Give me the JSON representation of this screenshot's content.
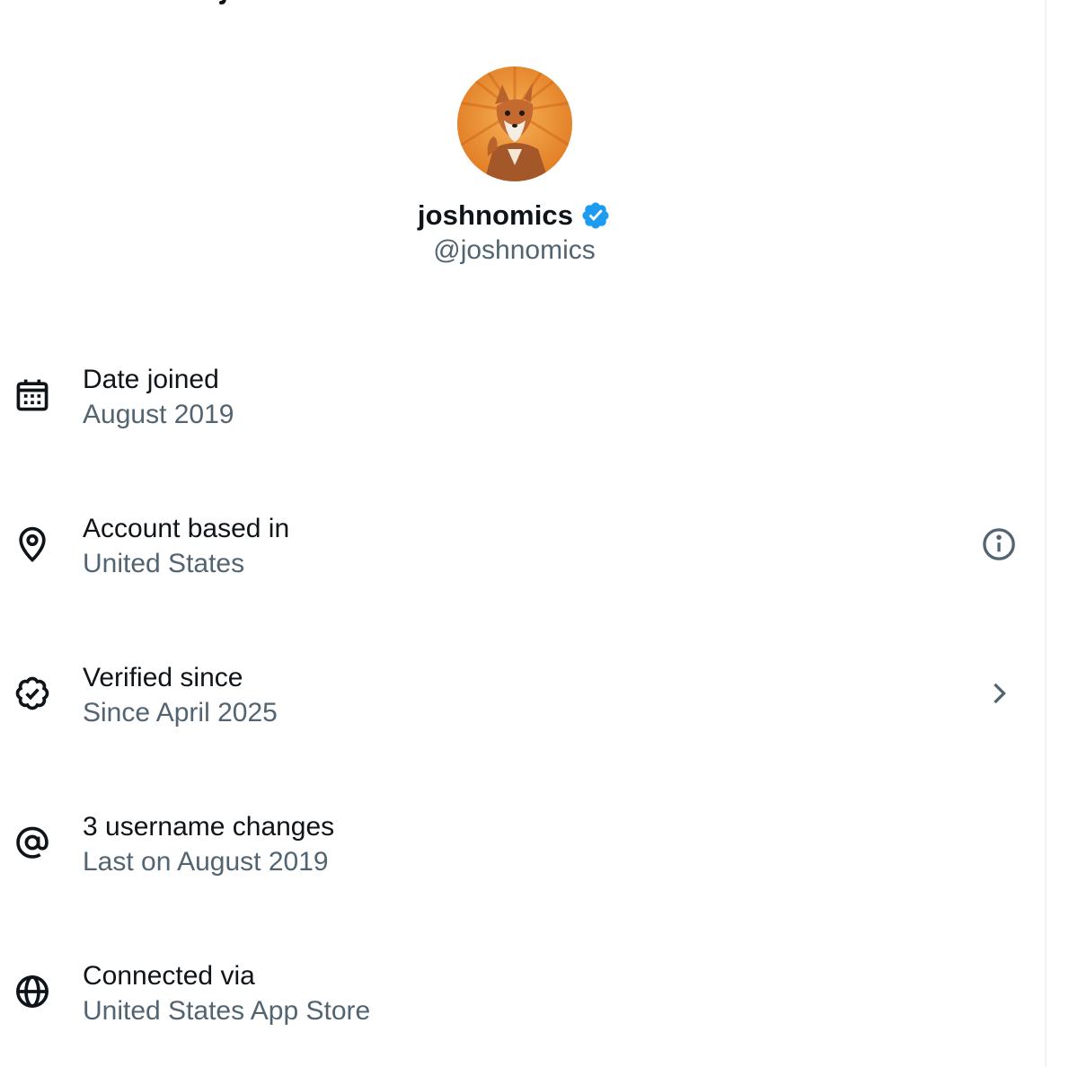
{
  "profile": {
    "display_name": "joshnomics",
    "handle": "@joshnomics",
    "verified": true
  },
  "colors": {
    "primary_text": "#0f1419",
    "secondary_text": "#536471",
    "verified_blue": "#1d9bf0",
    "avatar_orange": "#e8852a"
  },
  "rows": [
    {
      "icon": "calendar-icon",
      "label": "Date joined",
      "value": "August 2019",
      "action": null
    },
    {
      "icon": "location-pin-icon",
      "label": "Account based in",
      "value": "United States",
      "action": "info-icon"
    },
    {
      "icon": "verified-badge-outline-icon",
      "label": "Verified since",
      "value": "Since April 2025",
      "action": "chevron-right-icon"
    },
    {
      "icon": "at-sign-icon",
      "label": "3 username changes",
      "value": "Last on August 2019",
      "action": null
    },
    {
      "icon": "globe-icon",
      "label": "Connected via",
      "value": "United States App Store",
      "action": null
    }
  ]
}
